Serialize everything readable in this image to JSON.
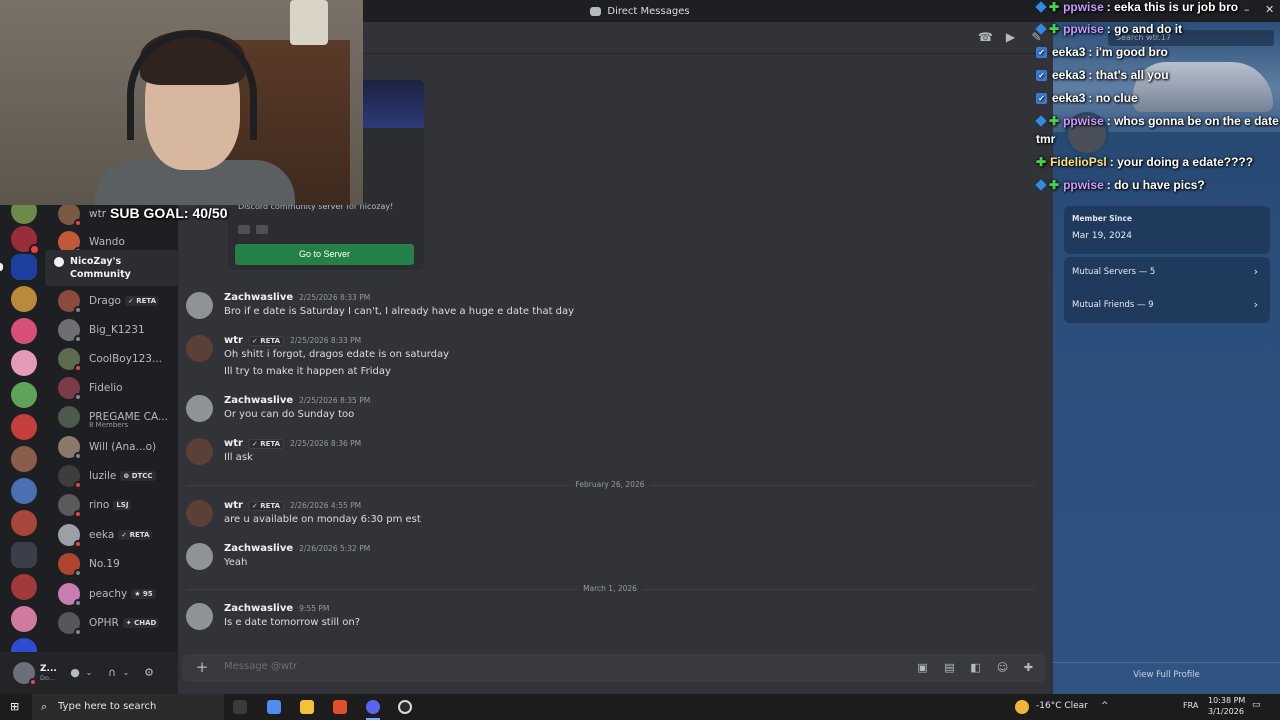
{
  "titlebar": {
    "title": "Direct Messages"
  },
  "stream": {
    "sub_goal": "SUB GOAL: 40/50",
    "chat": [
      {
        "user": "ppwise",
        "text": ": eeka this is ur job bro",
        "color": "#c89bff",
        "badges": "blue-green"
      },
      {
        "user": "ppwise",
        "text": ": go and do it",
        "color": "#c89bff",
        "badges": "blue-green"
      },
      {
        "user": "eeka3",
        "text": ": i'm good bro",
        "color": "#ffffff",
        "badges": "verified"
      },
      {
        "user": "eeka3",
        "text": ": that's all you",
        "color": "#ffffff",
        "badges": "verified"
      },
      {
        "user": "eeka3",
        "text": ": no clue",
        "color": "#ffffff",
        "badges": "verified"
      },
      {
        "user": "ppwise",
        "text": ": whos gonna be on the e date",
        "color": "#c89bff",
        "badges": "blue-green"
      },
      {
        "user": "",
        "text": "tmr",
        "color": "#ffffff",
        "badges": "none"
      },
      {
        "user": "FidelioPsl",
        "text": ": your doing a edate????",
        "color": "#ffe27a",
        "badges": "green"
      },
      {
        "user": "ppwise",
        "text": ": do u have pics?",
        "color": "#c89bff",
        "badges": "blue-green"
      }
    ]
  },
  "tooltip": {
    "label": "NicoZay's Community"
  },
  "dm_list": [
    {
      "name": "wtr",
      "tag": "",
      "sub": "",
      "color": "#7b5a45",
      "status": "dnd"
    },
    {
      "name": "Wando",
      "tag": "",
      "sub": "",
      "color": "#c1583a",
      "status": "offline"
    },
    {
      "name": "Drago",
      "tag": "✓ RETA",
      "sub": "",
      "color": "#8a4a3e",
      "status": "offline"
    },
    {
      "name": "Big_K1231",
      "tag": "",
      "sub": "",
      "color": "#6e6f73",
      "status": "offline"
    },
    {
      "name": "CoolBoy123...",
      "tag": "",
      "sub": "",
      "color": "#5e6b4e",
      "status": "dnd"
    },
    {
      "name": "Fidelio",
      "tag": "",
      "sub": "",
      "color": "#7d3b4a",
      "status": "offline"
    },
    {
      "name": "PREGAME CA...",
      "tag": "",
      "sub": "8 Members",
      "color": "#4d5a4b",
      "status": "none"
    },
    {
      "name": "Will (Ana...o)",
      "tag": "",
      "sub": "",
      "color": "#8a7a6a",
      "status": "offline"
    },
    {
      "name": "luzile",
      "tag": "⊚ DTCC",
      "sub": "",
      "color": "#3d3d3d",
      "status": "dnd"
    },
    {
      "name": "rino",
      "tag": "LSJ",
      "sub": "",
      "color": "#5a5a5a",
      "status": "dnd"
    },
    {
      "name": "eeka",
      "tag": "✓ RETA",
      "sub": "",
      "color": "#9aa0a6",
      "status": "dnd"
    },
    {
      "name": "No.19",
      "tag": "",
      "sub": "",
      "color": "#b0452f",
      "status": "offline"
    },
    {
      "name": "peachy",
      "tag": "★ 95",
      "sub": "",
      "color": "#c77db0",
      "status": "offline"
    },
    {
      "name": "OPHR",
      "tag": "✦ CHAD",
      "sub": "",
      "color": "#55575c",
      "status": "offline"
    }
  ],
  "user_panel": {
    "name": "Z...",
    "status": "Do..."
  },
  "server_card": {
    "description": "Discord community server for nicozay!",
    "button": "Go to Server"
  },
  "messages": [
    {
      "author": "Zachwaslive",
      "tag": "",
      "time": "2/25/2026 8:33 PM",
      "lines": [
        "Bro if e date is Saturday I can't, I already have a huge e date that day"
      ],
      "avatar": "#8f9296"
    },
    {
      "author": "wtr",
      "tag": "✓ RETA",
      "time": "2/25/2026 8:33 PM",
      "lines": [
        "Oh shitt i forgot, dragos edate is on saturday",
        "Ill try to make it happen at Friday"
      ],
      "avatar": "#5a4037"
    },
    {
      "author": "Zachwaslive",
      "tag": "",
      "time": "2/25/2026 8:35 PM",
      "lines": [
        "Or you can do Sunday too"
      ],
      "avatar": "#8f9296"
    },
    {
      "author": "wtr",
      "tag": "✓ RETA",
      "time": "2/25/2026 8:36 PM",
      "lines": [
        "Ill ask"
      ],
      "avatar": "#5a4037"
    },
    {
      "author": "wtr",
      "tag": "✓ RETA",
      "time": "2/26/2026 4:55 PM",
      "lines": [
        "are u available on monday 6:30 pm est"
      ],
      "avatar": "#5a4037"
    },
    {
      "author": "Zachwaslive",
      "tag": "",
      "time": "2/26/2026 5:32 PM",
      "lines": [
        "Yeah"
      ],
      "avatar": "#8f9296"
    },
    {
      "author": "Zachwaslive",
      "tag": "",
      "time": "9:55 PM",
      "lines": [
        "Is e date tomorrow still on?"
      ],
      "avatar": "#8f9296"
    }
  ],
  "dividers": [
    "February 26, 2026",
    "March 1, 2026"
  ],
  "composer": {
    "placeholder": "Message @wtr"
  },
  "profile": {
    "search_placeholder": "Search wtr.17",
    "member_since_label": "Member Since",
    "member_since_value": "Mar 19, 2024",
    "mutual_servers": "Mutual Servers — 5",
    "mutual_friends": "Mutual Friends — 9",
    "view_full": "View Full Profile"
  },
  "taskbar": {
    "search_placeholder": "Type here to search",
    "weather": "-16°C  Clear",
    "lang": "FRA",
    "time": "10:38 PM",
    "date": "3/1/2026"
  },
  "colors": {
    "accent_green": "#248046",
    "chat_bg": "#313338",
    "panel_blue": "#2a4d79"
  }
}
